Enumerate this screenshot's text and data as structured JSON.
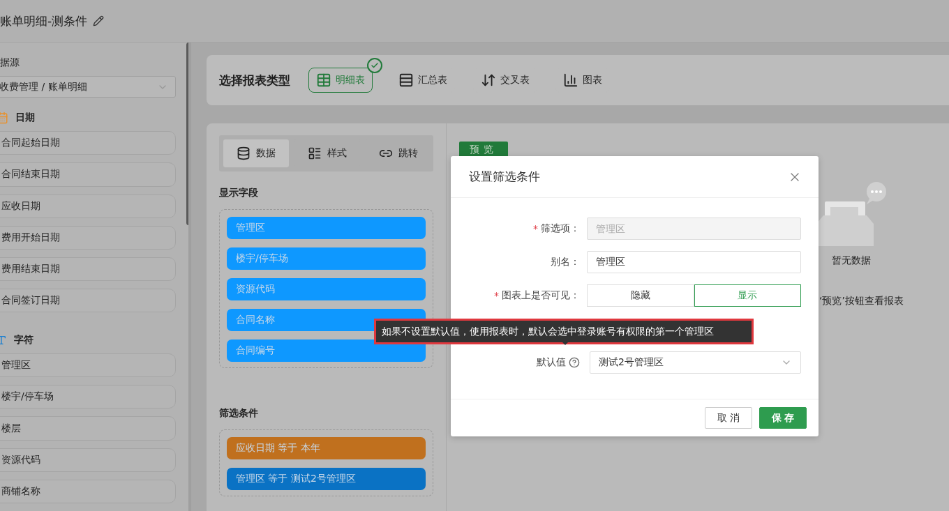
{
  "page": {
    "title": "账单明细-测条件"
  },
  "sidebar": {
    "datasource_label": "据源",
    "datasource": "收费管理 / 账单明细",
    "groups": [
      {
        "kind": "date",
        "title": "日期",
        "items": [
          "合同起始日期",
          "合同结束日期",
          "应收日期",
          "费用开始日期",
          "费用结束日期",
          "合同签订日期"
        ]
      },
      {
        "kind": "string",
        "title": "字符",
        "items": [
          "管理区",
          "楼宇/停车场",
          "楼层",
          "资源代码",
          "商铺名称"
        ]
      }
    ]
  },
  "report_types": {
    "title": "选择报表类型",
    "options": [
      {
        "label": "明细表",
        "kind": "detail",
        "selected": true
      },
      {
        "label": "汇总表",
        "kind": "summary",
        "selected": false
      },
      {
        "label": "交叉表",
        "kind": "cross",
        "selected": false
      },
      {
        "label": "图表",
        "kind": "chart",
        "selected": false
      }
    ]
  },
  "config_tabs": [
    {
      "label": "数据",
      "kind": "data",
      "selected": true
    },
    {
      "label": "样式",
      "kind": "style",
      "selected": false
    },
    {
      "label": "跳转",
      "kind": "link",
      "selected": false
    }
  ],
  "display_fields": {
    "title": "显示字段",
    "items": [
      "管理区",
      "楼宇/停车场",
      "资源代码",
      "合同名称",
      "合同编号"
    ]
  },
  "filter_conditions": {
    "title": "筛选条件",
    "items": [
      {
        "text": "应收日期 等于 本年",
        "color": "#c0701e"
      },
      {
        "text": "管理区 等于 测试2号管理区",
        "color": "#0a72c4"
      }
    ]
  },
  "preview_button": "预览",
  "empty_state": {
    "title": "暂无数据",
    "hint": "‘预览’按钮查看报表"
  },
  "dialog": {
    "title": "设置筛选条件",
    "fields": [
      {
        "kind": "text",
        "label": "筛选项：",
        "required_mark": "*",
        "disabled": true,
        "placeholder": "管理区"
      },
      {
        "kind": "text",
        "label": "别名：",
        "disabled": false,
        "value": "管理区"
      },
      {
        "kind": "toggle",
        "label": "图表上是否可见：",
        "required_mark": "*",
        "options": [
          {
            "label": "隐藏",
            "selected": false
          },
          {
            "label": "显示",
            "selected": true
          }
        ]
      },
      {
        "kind": "gap"
      },
      {
        "kind": "select",
        "label": "默认值",
        "help": true,
        "value": "测试2号管理区"
      }
    ],
    "buttons": [
      {
        "label": "取 消",
        "kind": "cancel"
      },
      {
        "label": "保 存",
        "kind": "primary"
      }
    ]
  },
  "tooltip": {
    "text": "如果不设置默认值，使用报表时，默认会选中登录账号有权限的第一个管理区"
  }
}
